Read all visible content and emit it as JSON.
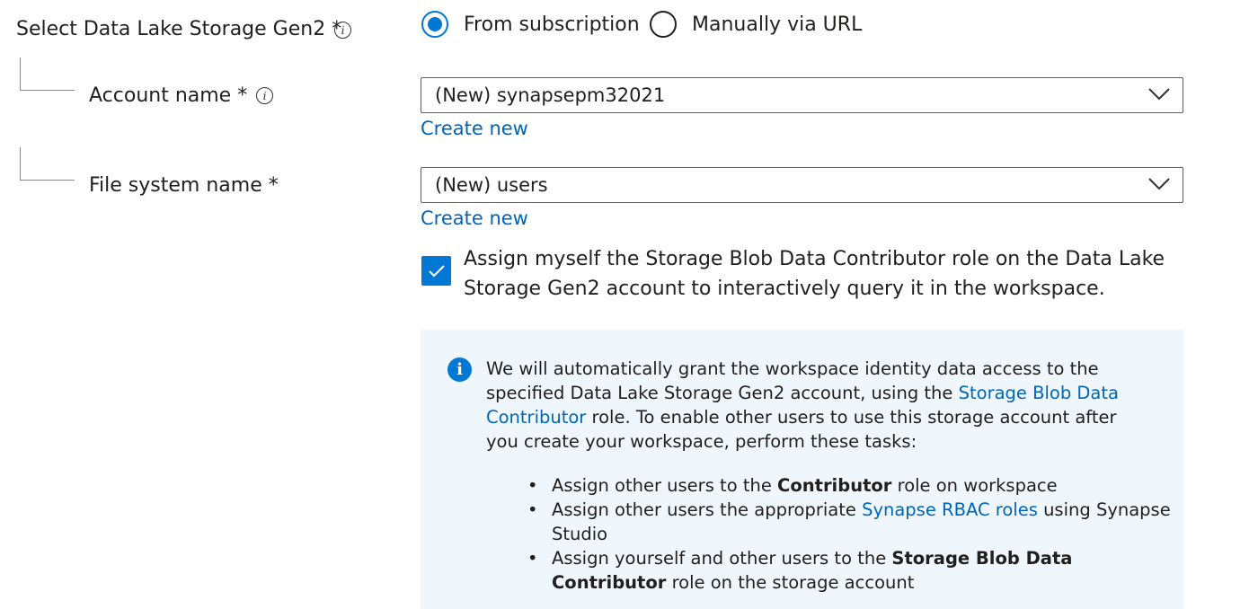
{
  "storage_selector": {
    "label": "Select Data Lake Storage Gen2",
    "required_mark": "*",
    "info_glyph": "i",
    "options": [
      {
        "label": "From subscription",
        "selected": true
      },
      {
        "label": "Manually via URL",
        "selected": false
      }
    ]
  },
  "account_name": {
    "label": "Account name",
    "required_mark": "*",
    "info_glyph": "i",
    "value": "(New) synapsepm32021",
    "create_new": "Create new"
  },
  "file_system_name": {
    "label": "File system name",
    "required_mark": "*",
    "value": "(New) users",
    "create_new": "Create new"
  },
  "role_checkbox": {
    "checked": true,
    "line1": "Assign myself the Storage Blob Data Contributor role on the Data Lake",
    "line2": "Storage Gen2 account to interactively query it in the workspace."
  },
  "info_message": {
    "icon_glyph": "i",
    "text_part1": "We will automatically grant the workspace identity data access to the specified Data Lake Storage Gen2 account, using the ",
    "link1": "Storage Blob Data Contributor",
    "text_part2": " role. To enable other users to use this storage account after you create your workspace, perform these tasks:",
    "bullet_glyph": "•",
    "bullets": [
      {
        "pre": "Assign other users to the ",
        "bold": "Contributor",
        "post": " role on workspace"
      },
      {
        "pre": "Assign other users the appropriate ",
        "link": "Synapse RBAC roles",
        "post": " using Synapse Studio"
      },
      {
        "pre": "Assign yourself and other users to the ",
        "bold": "Storage Blob Data Contributor",
        "post": " role on the storage account"
      }
    ]
  },
  "colors": {
    "accent": "#0078d4",
    "link": "#0066b8",
    "info_background": "#eff6fc",
    "text": "#201f1e"
  }
}
